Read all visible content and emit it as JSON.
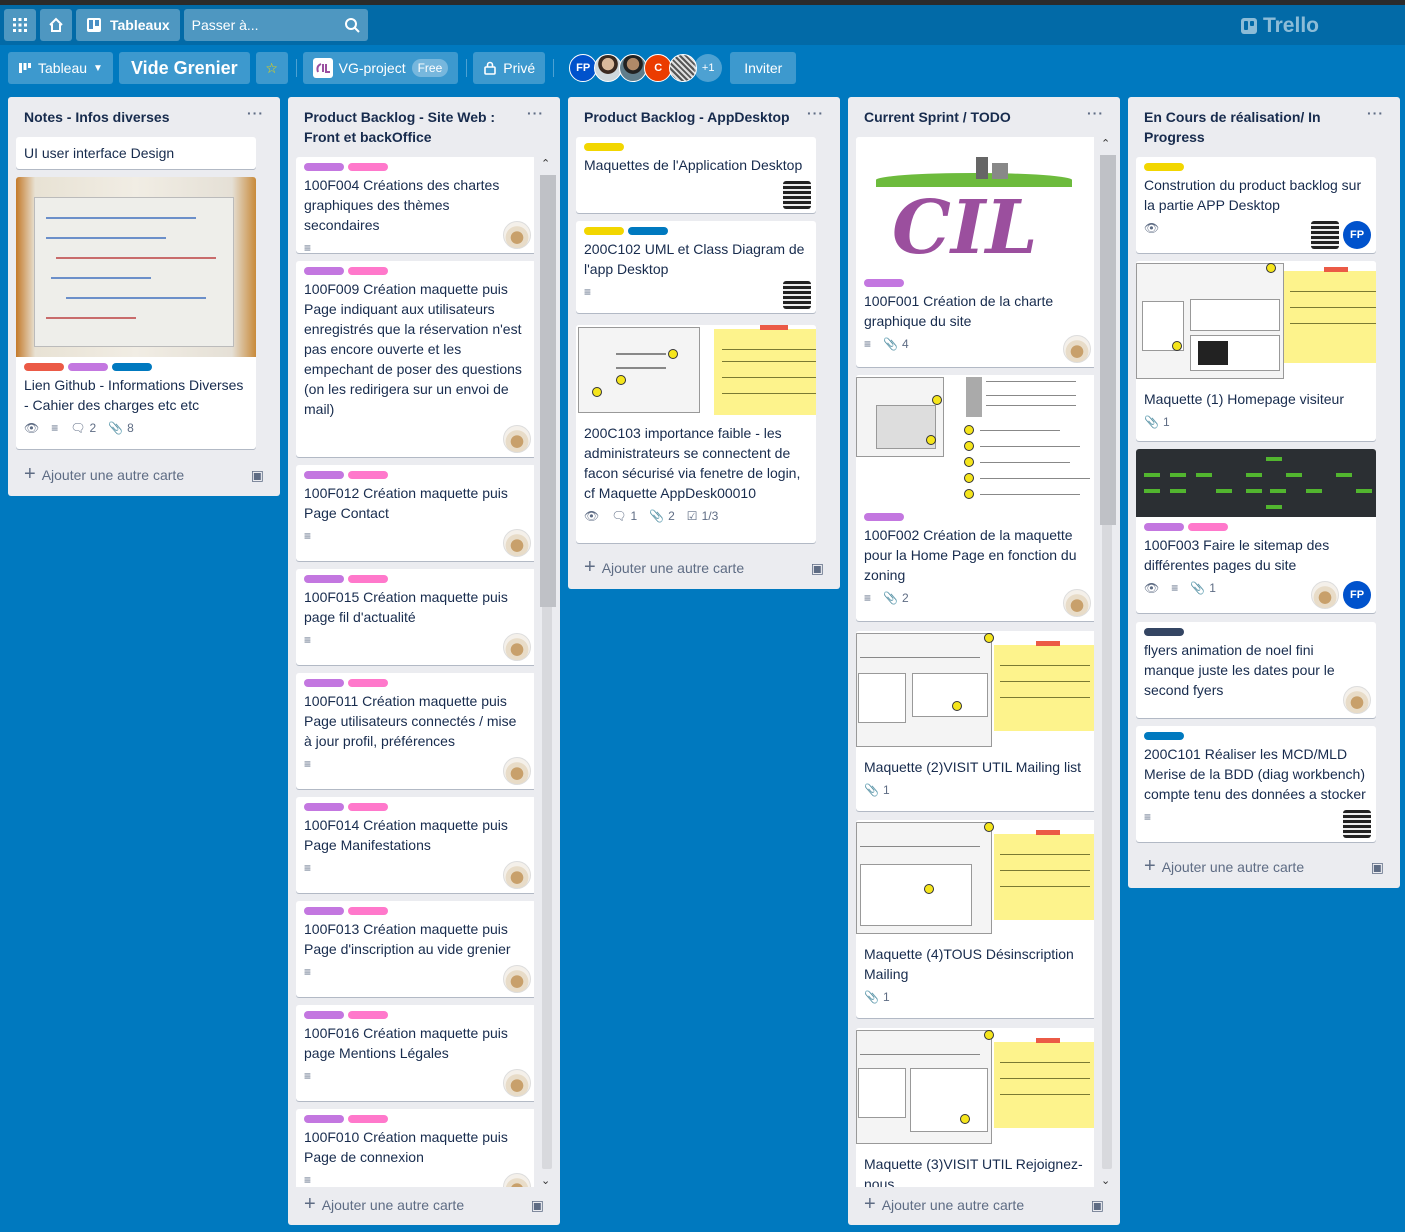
{
  "header": {
    "boards_label": "Tableaux",
    "search_placeholder": "Passer à...",
    "logo": "Trello"
  },
  "board": {
    "view_label": "Tableau",
    "title": "Vide Grenier",
    "workspace": "VG-project",
    "workspace_plan": "Free",
    "visibility": "Privé",
    "members": [
      "FP",
      "C",
      "+1"
    ],
    "invite_label": "Inviter"
  },
  "colors": {
    "board_bg": "#0079bf",
    "red": "#eb5a46",
    "purple": "#c377e0",
    "pink": "#ff78cb",
    "blue": "#0079bf",
    "yellow": "#f2d600",
    "black": "#344563"
  },
  "add_card_label": "Ajouter une autre carte",
  "lists": [
    {
      "title": "Notes - Infos diverses",
      "cards": [
        {
          "title": "UI user interface Design"
        },
        {
          "title": "Lien Github - Informations Diverses - Cahier des charges etc etc",
          "labels": [
            "red",
            "purple",
            "blue"
          ],
          "comments": "2",
          "attachments": "8"
        }
      ]
    },
    {
      "title": "Product Backlog - Site Web : Front et backOffice",
      "cards": [
        {
          "title": "100F004 Créations des chartes graphiques des thèmes secondaires"
        },
        {
          "title": "100F009 Création maquette puis Page indiquant aux utilisateurs enregistrés que la réservation n'est pas encore ouverte et les empechant de poser des questions (on les redirigera sur un envoi de mail)"
        },
        {
          "title": "100F012 Création maquette puis Page Contact"
        },
        {
          "title": "100F015 Création maquette puis page fil d'actualité"
        },
        {
          "title": "100F011 Création maquette puis Page utilisateurs connectés / mise à jour profil, préférences"
        },
        {
          "title": "100F014 Création maquette puis Page Manifestations"
        },
        {
          "title": "100F013 Création maquette puis Page d'inscription au vide grenier"
        },
        {
          "title": "100F016 Création maquette puis page Mentions Légales"
        },
        {
          "title": "100F010 Création maquette puis Page de connexion"
        }
      ]
    },
    {
      "title": "Product Backlog - AppDesktop",
      "cards": [
        {
          "title": "Maquettes de l'Application Desktop"
        },
        {
          "title": "200C102 UML et Class Diagram de l'app Desktop"
        },
        {
          "title": "200C103 importance faible - les administrateurs se connectent de facon sécurisé via fenetre de login, cf Maquette AppDesk00010",
          "comments": "1",
          "attachments": "2",
          "checklist": "1/3"
        }
      ]
    },
    {
      "title": "Current Sprint / TODO",
      "cards": [
        {
          "title": "100F001 Création de la charte graphique du site",
          "attachments": "4",
          "cover_text": "CIL"
        },
        {
          "title": "100F002 Création de la maquette pour la Home Page en fonction du zoning",
          "attachments": "2"
        },
        {
          "title": "Maquette (2)VISIT UTIL Mailing list",
          "attachments": "1"
        },
        {
          "title": "Maquette (4)TOUS Désinscription Mailing",
          "attachments": "1"
        },
        {
          "title": "Maquette (3)VISIT UTIL Rejoignez-nous"
        }
      ]
    },
    {
      "title": "En Cours de réalisation/ In Progress",
      "cards": [
        {
          "title": "Constrution du product backlog sur la partie APP Desktop",
          "member": "FP"
        },
        {
          "title": "Maquette (1) Homepage visiteur",
          "attachments": "1"
        },
        {
          "title": "100F003 Faire le sitemap des différentes pages du site",
          "attachments": "1",
          "member": "FP"
        },
        {
          "title": "flyers animation de noel fini manque juste les dates pour le second fyers"
        },
        {
          "title": "200C101 Réaliser les MCD/MLD Merise de la BDD (diag workbench) compte tenu des données a stocker"
        }
      ]
    }
  ]
}
